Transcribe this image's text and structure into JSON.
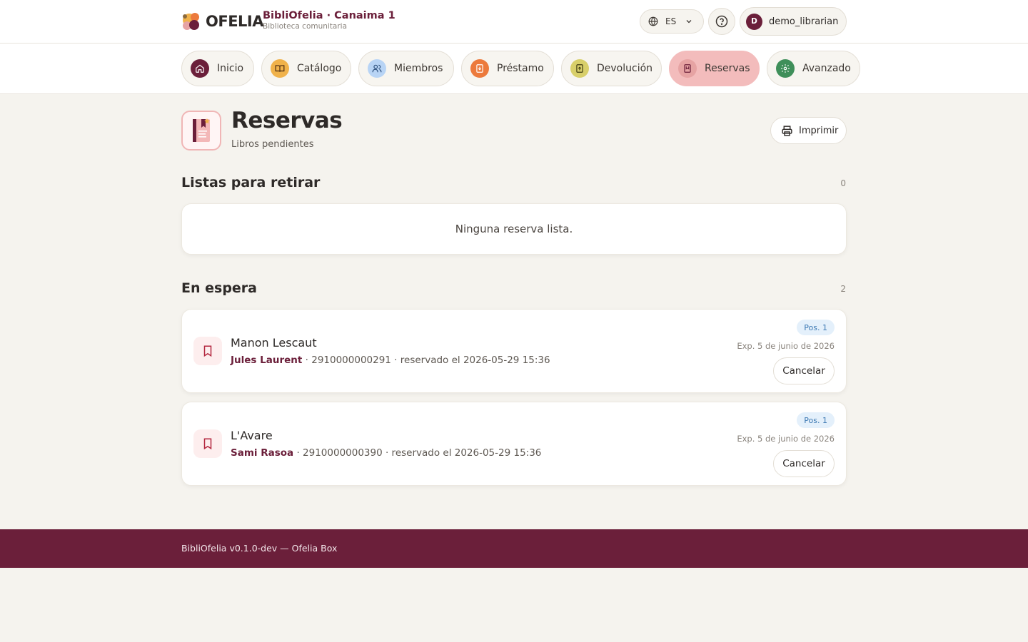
{
  "header": {
    "logo_text": "OFELIA",
    "brand_title": "BibliOfelia · Canaima 1",
    "brand_subtitle": "Biblioteca comunitaria",
    "language": "ES",
    "user": {
      "initial": "D",
      "name": "demo_librarian"
    }
  },
  "nav": {
    "items": [
      {
        "label": "Inicio",
        "icon": "home-icon",
        "color": "#6b1f3a"
      },
      {
        "label": "Catálogo",
        "icon": "book-open-icon",
        "color": "#f0b24b"
      },
      {
        "label": "Miembros",
        "icon": "users-icon",
        "color": "#b8d4f5"
      },
      {
        "label": "Préstamo",
        "icon": "checkout-icon",
        "color": "#ec7a3c"
      },
      {
        "label": "Devolución",
        "icon": "return-icon",
        "color": "#d8cf6a"
      },
      {
        "label": "Reservas",
        "icon": "bookmark-icon",
        "color": "#e6a3a3",
        "active": true
      },
      {
        "label": "Avanzado",
        "icon": "gear-icon",
        "color": "#3f8f5a"
      }
    ]
  },
  "page": {
    "title": "Reservas",
    "subtitle": "Libros pendientes",
    "print_label": "Imprimir"
  },
  "ready": {
    "title": "Listas para retirar",
    "count": "0",
    "empty_message": "Ninguna reserva lista."
  },
  "waiting": {
    "title": "En espera",
    "count": "2",
    "holds": [
      {
        "book": "Manon Lescaut",
        "member": "Jules Laurent",
        "details": " · 2910000000291 · reservado el 2026-05-29 15:36",
        "position": "Pos. 1",
        "expiry": "Exp. 5 de junio de 2026",
        "cancel_label": "Cancelar"
      },
      {
        "book": "L'Avare",
        "member": "Sami Rasoa",
        "details": " · 2910000000390 · reservado el 2026-05-29 15:36",
        "position": "Pos. 1",
        "expiry": "Exp. 5 de junio de 2026",
        "cancel_label": "Cancelar"
      }
    ]
  },
  "footer": {
    "text": "BibliOfelia v0.1.0-dev — Ofelia Box"
  }
}
